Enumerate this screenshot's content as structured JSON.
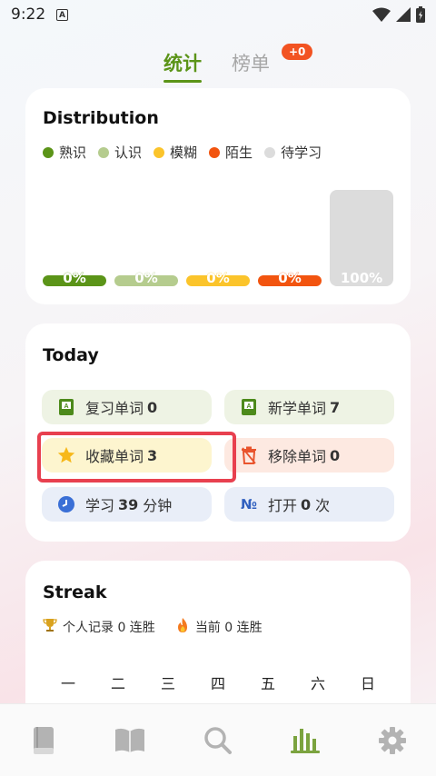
{
  "status": {
    "time": "9:22",
    "app_indicator": "A"
  },
  "tabs": {
    "stats": "统计",
    "ranking": "榜单",
    "ranking_badge": "+0"
  },
  "distribution": {
    "title": "Distribution",
    "legend": [
      {
        "label": "熟识",
        "color": "#5b9418"
      },
      {
        "label": "认识",
        "color": "#b5cc8e"
      },
      {
        "label": "模糊",
        "color": "#fbc42b"
      },
      {
        "label": "陌生",
        "color": "#f2540f"
      },
      {
        "label": "待学习",
        "color": "#dcdcdc"
      }
    ]
  },
  "chart_data": {
    "type": "bar",
    "title": "Distribution",
    "categories": [
      "熟识",
      "认识",
      "模糊",
      "陌生",
      "待学习"
    ],
    "values": [
      0,
      0,
      0,
      0,
      100
    ],
    "value_labels": [
      "0%",
      "0%",
      "0%",
      "0%",
      "100%"
    ],
    "colors": [
      "#5b9418",
      "#b5cc8e",
      "#fbc42b",
      "#f2540f",
      "#dcdcdc"
    ],
    "ylim": [
      0,
      100
    ],
    "unit": "%",
    "grid": false,
    "legend_position": "top-left"
  },
  "today": {
    "title": "Today",
    "review": {
      "label": "复习单词",
      "value": "0"
    },
    "new": {
      "label": "新学单词",
      "value": "7"
    },
    "favorite": {
      "label": "收藏单词",
      "value": "3"
    },
    "removed": {
      "label": "移除单词",
      "value": "0"
    },
    "study": {
      "label": "学习",
      "value": "39",
      "unit": "分钟"
    },
    "open": {
      "label": "打开",
      "value": "0",
      "unit": "次"
    }
  },
  "streak": {
    "title": "Streak",
    "record": "个人记录 0 连胜",
    "current": "当前 0 连胜",
    "weekdays": [
      "一",
      "二",
      "三",
      "四",
      "五",
      "六",
      "日"
    ]
  },
  "nav": {
    "icons": [
      "book-icon",
      "open-book-icon",
      "search-icon",
      "chart-icon",
      "gear-icon"
    ],
    "active_index": 3
  }
}
